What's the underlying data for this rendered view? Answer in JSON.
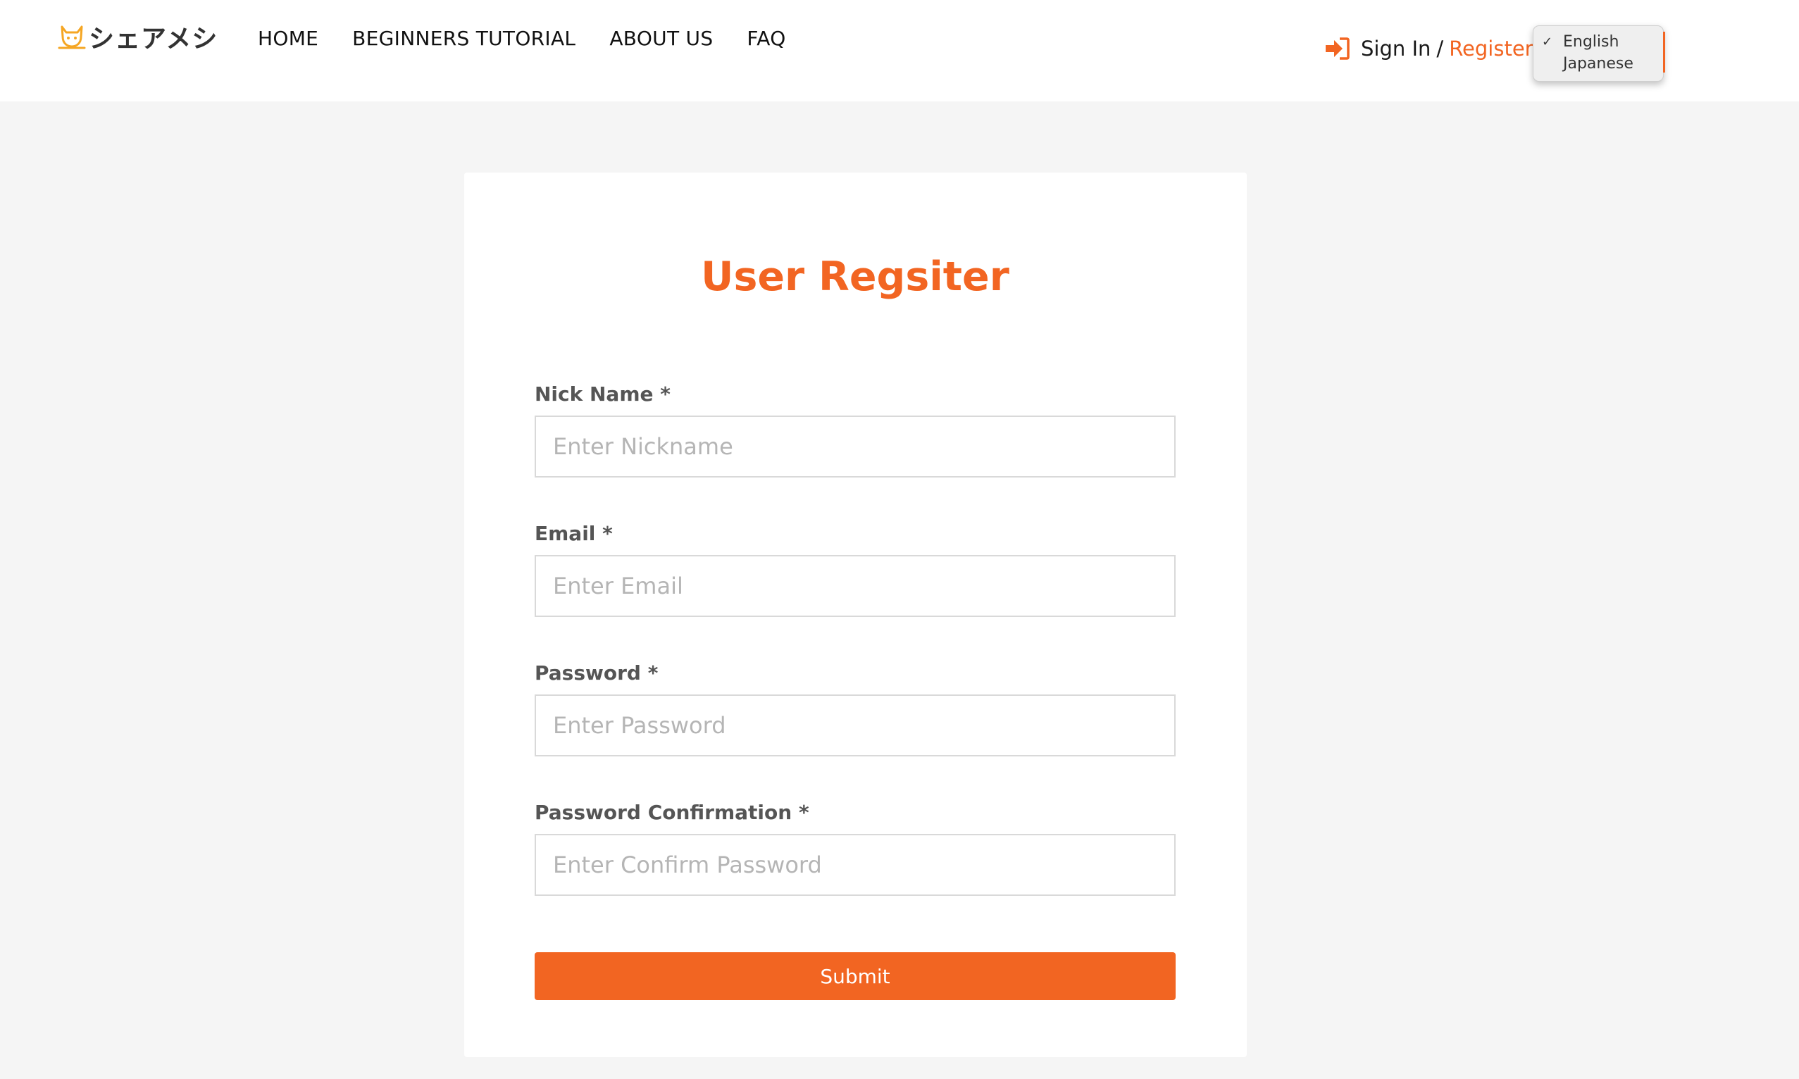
{
  "brand": {
    "logo_text": "シェアメシ",
    "accent_color": "#f26522",
    "icon": "cat-mascot-icon"
  },
  "nav": {
    "items": [
      {
        "label": "HOME"
      },
      {
        "label": "BEGINNERS TUTORIAL"
      },
      {
        "label": "ABOUT US"
      },
      {
        "label": "FAQ"
      }
    ]
  },
  "auth": {
    "icon": "sign-in-icon",
    "signin_label": "Sign In",
    "separator": "/",
    "register_label": "Register"
  },
  "language": {
    "selected": "English",
    "options": [
      "English",
      "Japanese"
    ],
    "check_mark": "✓"
  },
  "form": {
    "title": "User Regsiter",
    "fields": [
      {
        "label": "Nick Name *",
        "placeholder": "Enter Nickname",
        "value": ""
      },
      {
        "label": "Email *",
        "placeholder": "Enter Email",
        "value": ""
      },
      {
        "label": "Password *",
        "placeholder": "Enter Password",
        "value": ""
      },
      {
        "label": "Password Confirmation *",
        "placeholder": "Enter Confirm Password",
        "value": ""
      }
    ],
    "submit_label": "Submit"
  }
}
